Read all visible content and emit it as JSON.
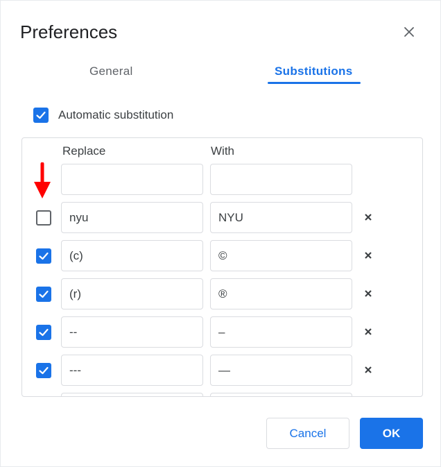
{
  "dialog": {
    "title": "Preferences"
  },
  "tabs": [
    {
      "label": "General",
      "active": false
    },
    {
      "label": "Substitutions",
      "active": true
    }
  ],
  "automatic_substitution": {
    "label": "Automatic substitution",
    "checked": true
  },
  "table": {
    "replace_header": "Replace",
    "with_header": "With",
    "new_row": {
      "replace": "",
      "with": ""
    },
    "rows": [
      {
        "enabled": false,
        "replace": "nyu",
        "with": "NYU"
      },
      {
        "enabled": true,
        "replace": "(c)",
        "with": "©"
      },
      {
        "enabled": true,
        "replace": "(r)",
        "with": "®"
      },
      {
        "enabled": true,
        "replace": "--",
        "with": "–"
      },
      {
        "enabled": true,
        "replace": "---",
        "with": "—"
      }
    ]
  },
  "buttons": {
    "cancel": "Cancel",
    "ok": "OK"
  },
  "colors": {
    "accent": "#1a73e8",
    "annotation_arrow": "#ff0000",
    "border": "#dadce0"
  },
  "icons": {
    "close": "close-icon",
    "delete": "delete-x-icon",
    "check": "checkmark-icon",
    "annotation": "red-down-arrow-icon"
  }
}
